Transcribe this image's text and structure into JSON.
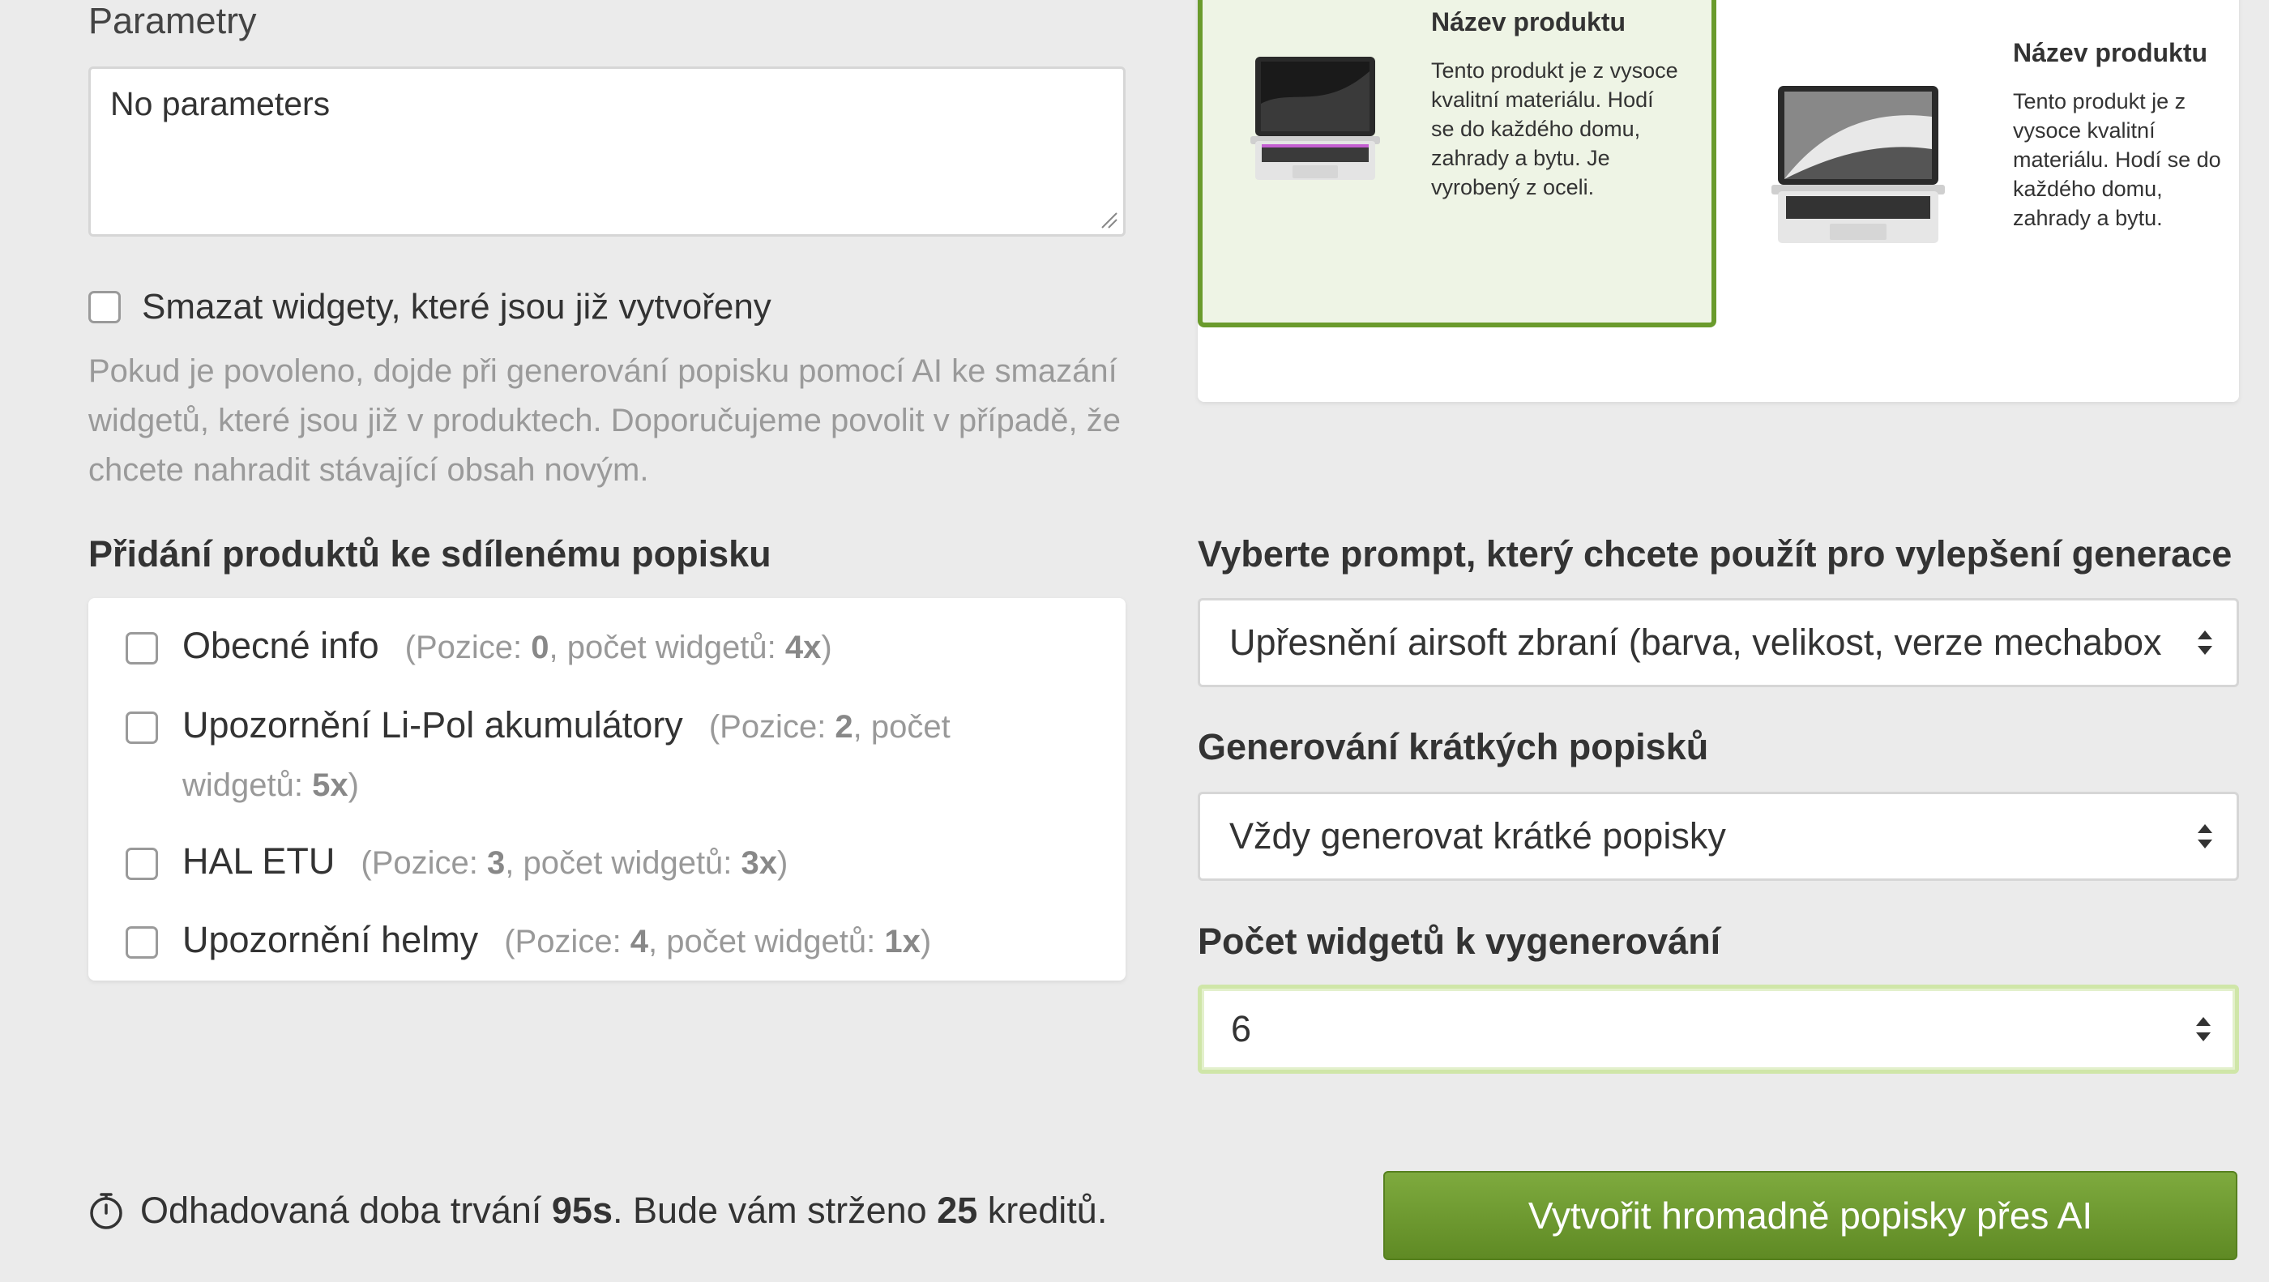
{
  "parameters": {
    "label": "Parametry",
    "value": "No parameters"
  },
  "delete_widgets": {
    "label": "Smazat widgety, které jsou již vytvořeny",
    "help": "Pokud je povoleno, dojde při generování popisku pomocí AI ke smazání widgetů, které jsou již v produktech. Doporučujeme povolit v případě, že chcete nahradit stávající obsah novým."
  },
  "shared": {
    "heading": "Přidání produktů ke sdílenému popisku",
    "items": [
      {
        "name": "Obecné info",
        "meta_a": "(Pozice: ",
        "pos": "0",
        "meta_b": ", počet widgetů: ",
        "count": "4x",
        "meta_c": ")"
      },
      {
        "name": "Upozornění Li-Pol akumulátory",
        "meta_a": "(Pozice: ",
        "pos": "2",
        "meta_b": ", počet widgetů: ",
        "count": "5x",
        "meta_c": ")"
      },
      {
        "name": "HAL ETU",
        "meta_a": "(Pozice: ",
        "pos": "3",
        "meta_b": ", počet widgetů: ",
        "count": "3x",
        "meta_c": ")"
      },
      {
        "name": "Upozornění helmy",
        "meta_a": "(Pozice: ",
        "pos": "4",
        "meta_b": ", počet widgetů: ",
        "count": "1x",
        "meta_c": ")"
      }
    ]
  },
  "preview": {
    "products": [
      {
        "title": "Název produktu",
        "desc": "Tento produkt je z vysoce kvalitní materiálu. Hodí se do každého domu, zahrady a bytu. Je vyrobený z oceli."
      },
      {
        "title": "Název produktu",
        "desc": "Tento produkt je z vysoce kvalitní materiálu. Hodí se do každého domu, zahrady a bytu."
      }
    ]
  },
  "prompt": {
    "label": "Vyberte prompt, který chcete použít pro vylepšení generace",
    "value": "Upřesnění airsoft zbraní (barva, velikost, verze mechabox"
  },
  "short_desc": {
    "label": "Generování krátkých popisků",
    "value": "Vždy generovat krátké popisky"
  },
  "widget_count": {
    "label": "Počet widgetů k vygenerování",
    "value": "6"
  },
  "estimate": {
    "prefix": "Odhadovaná doba trvání ",
    "duration": "95s",
    "middle": ". Bude vám strženo ",
    "credits": "25",
    "suffix": " kreditů."
  },
  "create_button": "Vytvořit hromadně popisky přes AI"
}
